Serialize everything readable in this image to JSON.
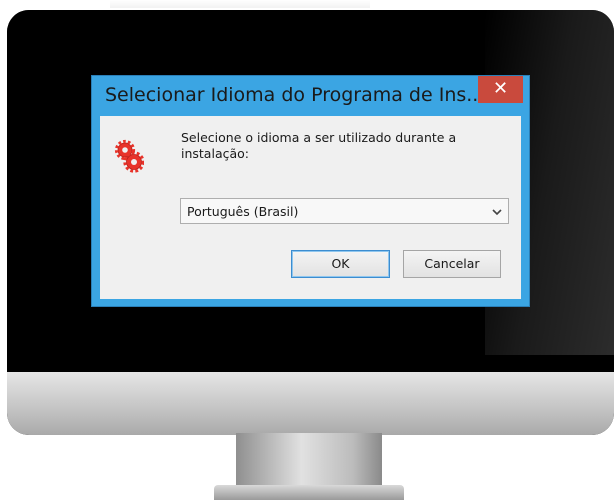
{
  "dialog": {
    "title": "Selecionar Idioma do Programa de Ins...",
    "close_icon": "close-icon",
    "setup_icon": "gear-icon",
    "prompt": "Selecione o idioma a ser utilizado durante a instalação:",
    "language_select": {
      "selected_value": "Português (Brasil)",
      "icon": "chevron-down-icon"
    },
    "ok_label": "OK",
    "cancel_label": "Cancelar"
  },
  "colors": {
    "title_bar": "#3ba5e3",
    "close_button": "#c94a3d",
    "client_area": "#f0f0f0",
    "gear": "#e8332a"
  }
}
